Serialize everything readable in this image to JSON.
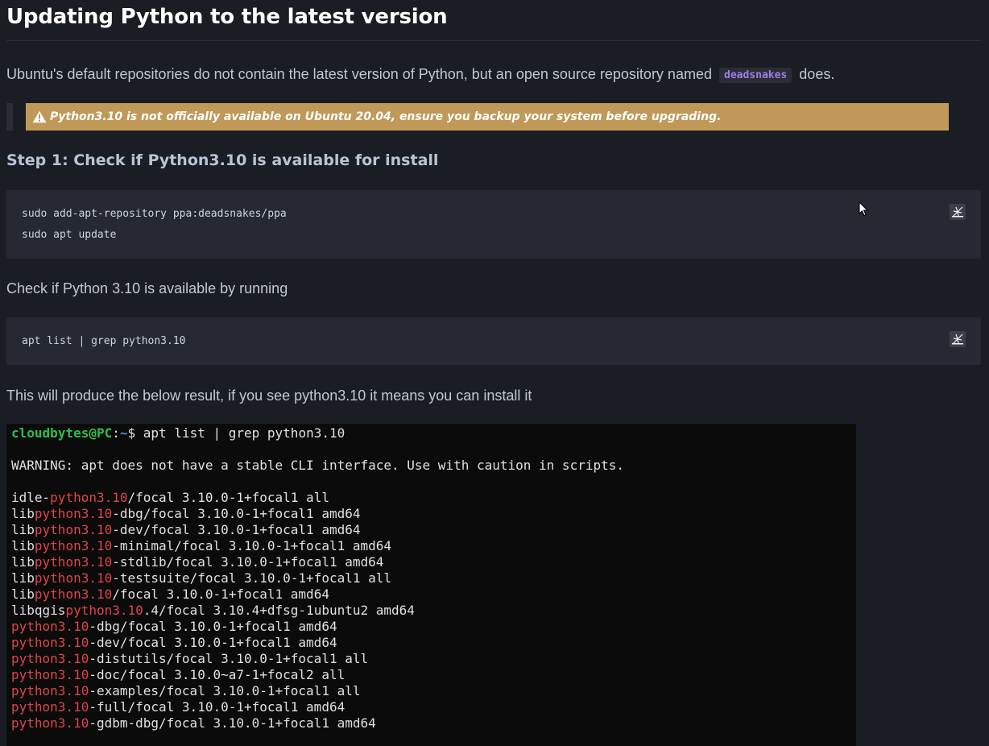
{
  "heading": "Updating Python to the latest version",
  "intro": {
    "before": "Ubuntu's default repositories do not contain the latest version of Python, but an open source repository named",
    "code": "deadsnakes",
    "after": "does."
  },
  "warning": "Python3.10 is not officially available on Ubuntu 20.04, ensure you backup your system before upgrading.",
  "step1_title": "Step 1: Check if Python3.10 is available for install",
  "code_block_1": [
    "sudo add-apt-repository ppa:deadsnakes/ppa",
    "sudo apt update"
  ],
  "para_check": "Check if Python 3.10 is available by running",
  "code_block_2": [
    "apt list | grep python3.10"
  ],
  "para_result": "This will produce the below result, if you see python3.10 it means you can install it",
  "terminal": {
    "prompt_user": "cloudbytes@PC",
    "prompt_colon": ":",
    "prompt_path": "~",
    "prompt_command": "$ apt list | grep python3.10",
    "warning": "WARNING: apt does not have a stable CLI interface. Use with caution in scripts.",
    "highlight": "python3.10",
    "packages": [
      {
        "pre": "idle-",
        "hl": "python3.10",
        "post": "/focal 3.10.0-1+focal1 all"
      },
      {
        "pre": "lib",
        "hl": "python3.10",
        "post": "-dbg/focal 3.10.0-1+focal1 amd64"
      },
      {
        "pre": "lib",
        "hl": "python3.10",
        "post": "-dev/focal 3.10.0-1+focal1 amd64"
      },
      {
        "pre": "lib",
        "hl": "python3.10",
        "post": "-minimal/focal 3.10.0-1+focal1 amd64"
      },
      {
        "pre": "lib",
        "hl": "python3.10",
        "post": "-stdlib/focal 3.10.0-1+focal1 amd64"
      },
      {
        "pre": "lib",
        "hl": "python3.10",
        "post": "-testsuite/focal 3.10.0-1+focal1 all"
      },
      {
        "pre": "lib",
        "hl": "python3.10",
        "post": "/focal 3.10.0-1+focal1 amd64"
      },
      {
        "pre": "libqgis",
        "hl": "python3.10",
        "post": ".4/focal 3.10.4+dfsg-1ubuntu2 amd64"
      },
      {
        "pre": "",
        "hl": "python3.10",
        "post": "-dbg/focal 3.10.0-1+focal1 amd64"
      },
      {
        "pre": "",
        "hl": "python3.10",
        "post": "-dev/focal 3.10.0-1+focal1 amd64"
      },
      {
        "pre": "",
        "hl": "python3.10",
        "post": "-distutils/focal 3.10.0-1+focal1 all"
      },
      {
        "pre": "",
        "hl": "python3.10",
        "post": "-doc/focal 3.10.0~a7-1+focal2 all"
      },
      {
        "pre": "",
        "hl": "python3.10",
        "post": "-examples/focal 3.10.0-1+focal1 all"
      },
      {
        "pre": "",
        "hl": "python3.10",
        "post": "-full/focal 3.10.0-1+focal1 amd64"
      },
      {
        "pre": "",
        "hl": "python3.10",
        "post": "-gdbm-dbg/focal 3.10.0-1+focal1 amd64"
      }
    ]
  },
  "icons": {
    "warning": "warning-triangle-icon",
    "copy": "copy-code-icon",
    "cursor": "mouse-cursor-icon"
  },
  "colors": {
    "background": "#1b1d24",
    "code_bg": "#262932",
    "warning_bg": "#c09858",
    "inline_code": "#a07ee8",
    "terminal_bg": "#0b0b0b",
    "terminal_green": "#2ec04a",
    "terminal_blue": "#4d8ae6",
    "terminal_red": "#e0444a"
  }
}
